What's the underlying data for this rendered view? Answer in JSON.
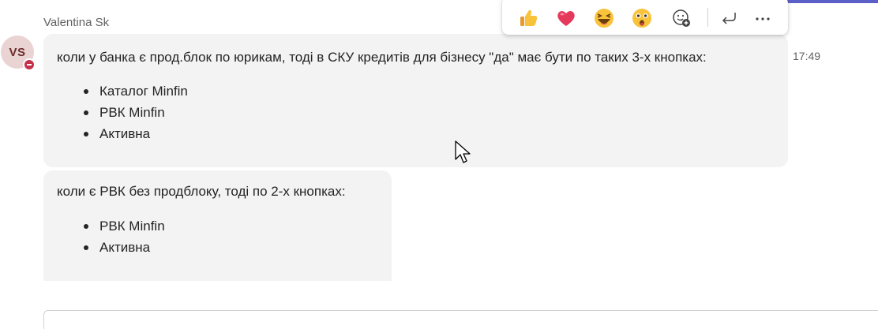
{
  "sender": {
    "name": "Valentina Sk",
    "initials": "VS"
  },
  "messages": [
    {
      "text": "коли у банка є прод.блок по юрикам, тоді в СКУ кредитів для бізнесу \"да\" має бути по таких 3-х кнопках:",
      "items": [
        "Каталог Minfin",
        "РВК Minfin",
        "Активна"
      ],
      "time": "17:49"
    },
    {
      "text": "коли є РВК без продблоку, тоді по 2-х кнопках:",
      "items": [
        "РВК Minfin",
        "Активна"
      ]
    }
  ],
  "reactions": [
    "thumbs-up",
    "heart",
    "laughing",
    "surprised",
    "add-reaction"
  ],
  "actions": [
    "reply",
    "more-options"
  ],
  "presence_status": "do-not-disturb",
  "colors": {
    "accent": "#5b5fc7",
    "bubble": "#f3f3f3",
    "presence_dnd": "#c4314b",
    "avatar_bg": "#ead3d3"
  }
}
